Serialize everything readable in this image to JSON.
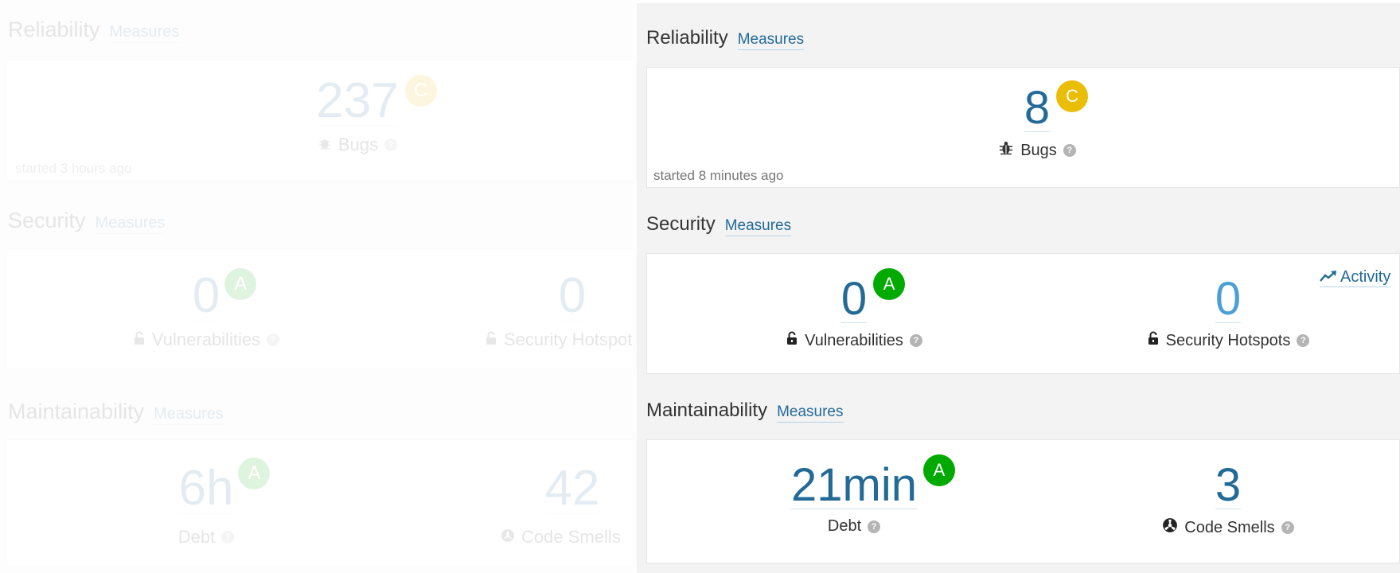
{
  "colors": {
    "accent": "#236a97",
    "rating_a": "#00aa00",
    "rating_c": "#eabe06",
    "panel_bg": "#f3f3f3"
  },
  "ghost": {
    "reliability": {
      "title": "Reliability",
      "measures": "Measures",
      "bugs_value": "237",
      "bugs_rating": "C",
      "bugs_label": "Bugs",
      "started": "started 3 hours ago"
    },
    "security": {
      "title": "Security",
      "measures": "Measures",
      "vuln_value": "0",
      "vuln_rating": "A",
      "vuln_label": "Vulnerabilities",
      "hotspots_value": "0",
      "hotspots_label": "Security Hotspot"
    },
    "maintainability": {
      "title": "Maintainability",
      "measures": "Measures",
      "debt_value": "6h",
      "debt_rating": "A",
      "debt_label": "Debt",
      "smells_value": "42",
      "smells_label": "Code Smells"
    }
  },
  "main": {
    "reliability": {
      "title": "Reliability",
      "measures": "Measures",
      "bugs_value": "8",
      "bugs_rating": "C",
      "bugs_label": "Bugs",
      "started": "started 8 minutes ago"
    },
    "security": {
      "title": "Security",
      "measures": "Measures",
      "activity": "Activity",
      "vuln_value": "0",
      "vuln_rating": "A",
      "vuln_label": "Vulnerabilities",
      "hotspots_value": "0",
      "hotspots_label": "Security Hotspots"
    },
    "maintainability": {
      "title": "Maintainability",
      "measures": "Measures",
      "debt_value": "21min",
      "debt_rating": "A",
      "debt_label": "Debt",
      "smells_value": "3",
      "smells_label": "Code Smells"
    }
  },
  "icons": {
    "bug": "bug-icon",
    "lock": "unlock-icon",
    "smell": "code-smell-icon",
    "help": "help-icon",
    "activity": "trend-icon"
  },
  "help_glyph": "?"
}
